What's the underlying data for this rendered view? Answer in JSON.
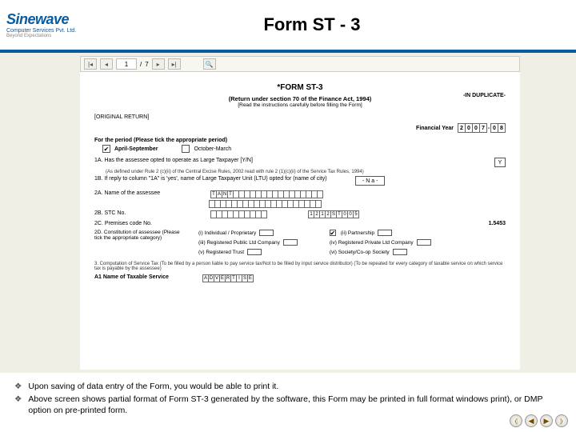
{
  "logo": {
    "brand": "Sinewave",
    "sub": "Computer Services Pvt. Ltd.",
    "tag": "Beyond Expectations"
  },
  "title": "Form ST - 3",
  "toolbar": {
    "page_current": "1",
    "page_total": "7"
  },
  "form": {
    "heading": "*FORM ST-3",
    "duplicate": "-IN DUPLICATE-",
    "subheading1": "(Return under section 70 of the Finance Act, 1994)",
    "subheading2": "[Read the instructions carefully before filling the Form]",
    "original_return": "[ORIGINAL RETURN]",
    "fy_label": "Financial Year",
    "fy_cells": [
      "2",
      "0",
      "0",
      "7",
      "-",
      "0",
      "8"
    ],
    "period_label": "For the period (Please tick the appropriate period)",
    "period_a": "April-September",
    "period_b": "October-March",
    "q1A_label": "1A. Has the assessee opted to operate as Large Taxpayer [Y/N]",
    "q1A_hint": "(As defined under Rule 2 (c)(ii) of the Central Excise Rules, 2002 read with rule 2 (1)(c)(ii) of the Service Tax Rules, 1994)",
    "q1A_val": "Y",
    "q1B_label": "1B. If reply to column \"1A\" is 'yes', name of Large Taxpayer Unit (LTU) opted for (name of city)",
    "q1B_val": "- N a -",
    "q2A_label": "2A. Name of the assessee",
    "q2A_letters": [
      "T",
      "A",
      "N",
      "T"
    ],
    "q2B_label": "2B. STC No.",
    "q2B_right": [
      "1",
      "2",
      "1",
      "2",
      "S",
      "T",
      "0",
      "0",
      "5"
    ],
    "q2C_label": "2C. Premises code No.",
    "q2C_right": "1.5453",
    "q2D_label": "2D. Constitution of assessee (Please tick the appropriate category)",
    "c_i": "(i) Individual / Proprietary",
    "c_ii": "(ii) Partnership",
    "c_iii": "(iii) Registered Public Ltd Company",
    "c_iv": "(iv) Registered Private Ltd Company",
    "c_v": "(v) Registered Trust",
    "c_vi": "(vi) Society/Co-op Society",
    "sec3": "3. Computation of Service Tax (To be filled by a person liable to pay service tax/Not to be filled by input service distributor) (To be repeated for every category of taxable service on which service tax is payable by the assessee)",
    "a1_label": "A1  Name of Taxable Service",
    "a1_letters": [
      "A",
      "D",
      "V",
      "E",
      "R",
      "T",
      "I",
      "S",
      "E"
    ]
  },
  "footer": {
    "b1": "Upon saving of data entry of the Form, you would be able to  print it.",
    "b2": "Above screen shows partial format of Form ST-3 generated by the software, this Form may be printed in full format windows print), or DMP option on pre-printed form."
  }
}
